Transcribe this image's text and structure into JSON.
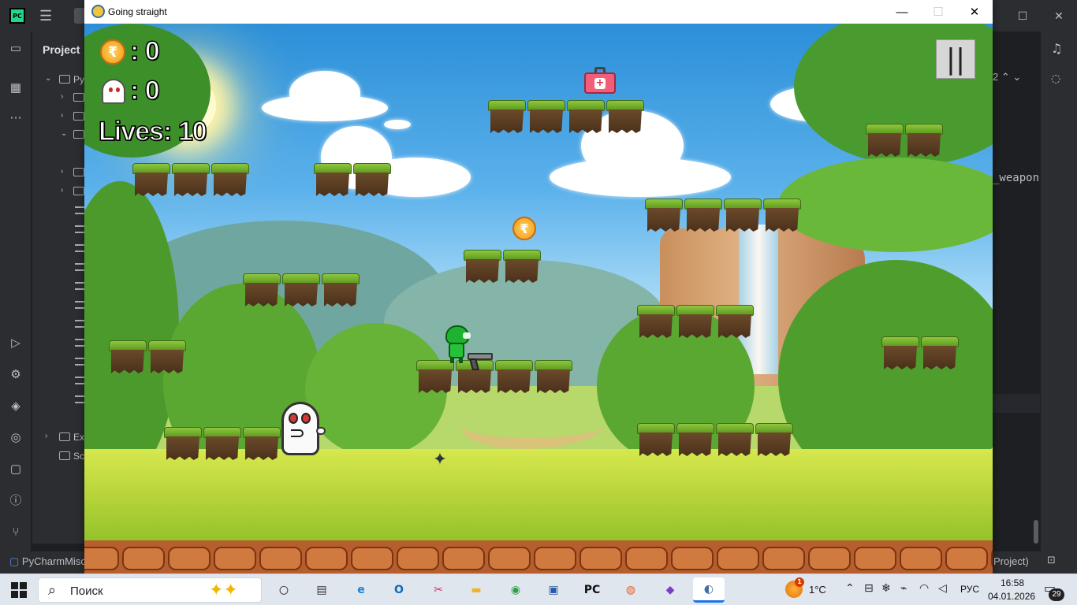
{
  "ide": {
    "logo_text": "PC",
    "project_label": "Project",
    "tree_items": [
      "Py",
      "",
      "",
      "",
      "",
      "",
      "",
      "",
      "",
      "",
      "",
      "",
      "",
      "",
      "",
      "",
      "Ex",
      "Sc"
    ],
    "code_fragment": "_weapon",
    "occurrence_counter": "2",
    "status_left": "PyCharmMisc",
    "status_right": "Project)"
  },
  "game": {
    "window_title": "Going straight",
    "hud": {
      "coins_text": ": 0",
      "kills_text": ": 0",
      "lives_text": "Lives: 10",
      "coin_symbol": "₹"
    },
    "pause_symbol": "||",
    "pickup_coin_symbol": "₹",
    "medkit_symbol": "+"
  },
  "taskbar": {
    "search_label": "Поиск",
    "apps": [
      {
        "name": "task-view",
        "glyph": "○"
      },
      {
        "name": "widgets",
        "glyph": "▤"
      },
      {
        "name": "edge",
        "glyph": "e"
      },
      {
        "name": "outlook",
        "glyph": "O"
      },
      {
        "name": "snipping-tool",
        "glyph": "✂"
      },
      {
        "name": "file-explorer",
        "glyph": "▬"
      },
      {
        "name": "chrome",
        "glyph": "◉"
      },
      {
        "name": "remote-desktop",
        "glyph": "▣"
      },
      {
        "name": "pycharm",
        "glyph": "PC"
      },
      {
        "name": "firefox",
        "glyph": "◍"
      },
      {
        "name": "visual-studio",
        "glyph": "◆"
      },
      {
        "name": "pygame",
        "glyph": "◐"
      }
    ],
    "weather_badge": "1",
    "temperature": "1°C",
    "language": "РУС",
    "time": "16:58",
    "date": "04.01.2026",
    "notification_count": "29"
  },
  "colors": {
    "pycharm_green": "#21d789",
    "player_green": "#1db32f",
    "coin_orange": "#f29a1a",
    "medkit_pink": "#f25d7a",
    "ghost_eye_red": "#d43838"
  }
}
